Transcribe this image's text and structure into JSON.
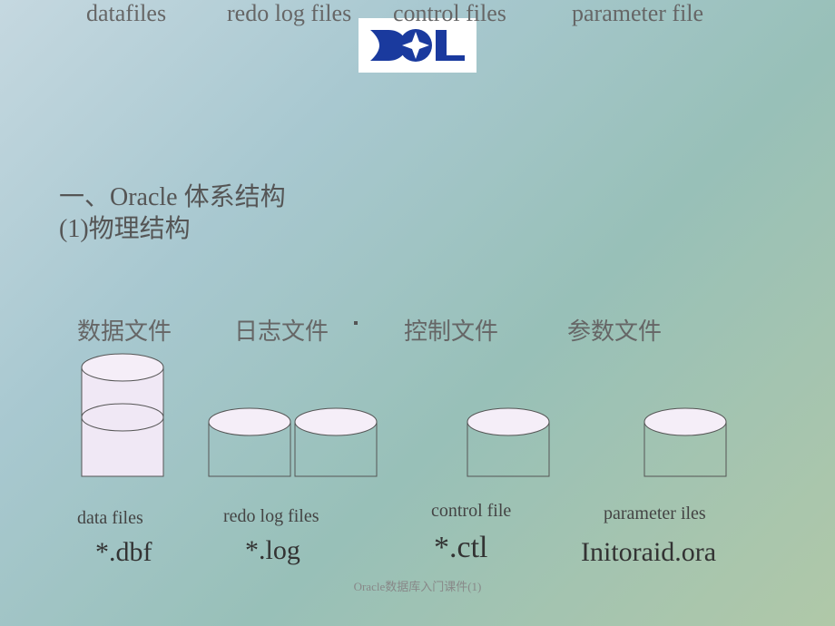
{
  "heading1": "一、Oracle  体系结构",
  "heading2": "(1)物理结构",
  "columns": {
    "datafiles": {
      "en": "datafiles",
      "cn": "数据文件",
      "bottom": "data files",
      "ext": "*.dbf"
    },
    "redolog": {
      "en": "redo log files",
      "cn": "日志文件",
      "bottom": "redo log files",
      "ext": "*.log"
    },
    "control": {
      "en": "control  files",
      "cn": "控制文件",
      "bottom": "control file",
      "ext": "*.ctl"
    },
    "parameter": {
      "en": "parameter  file",
      "cn": "参数文件",
      "bottom": "parameter iles",
      "ext": "Initoraid.ora"
    }
  },
  "footer": "Oracle数据库入门课件(1)"
}
